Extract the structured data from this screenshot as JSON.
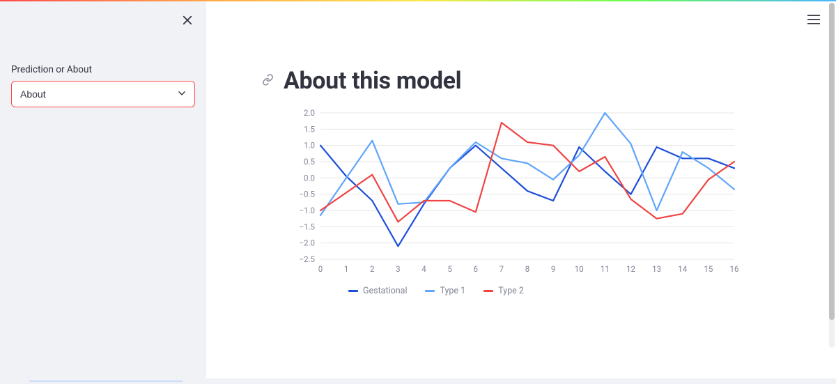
{
  "sidebar": {
    "label": "Prediction or About",
    "selected": "About"
  },
  "main": {
    "title": "About this model"
  },
  "chart_data": {
    "type": "line",
    "x": [
      0,
      1,
      2,
      3,
      4,
      5,
      6,
      7,
      8,
      9,
      10,
      11,
      12,
      13,
      14,
      15,
      16
    ],
    "xlim": [
      0,
      16
    ],
    "ylim": [
      -2.5,
      2.0
    ],
    "yticks": [
      -2.5,
      -2.0,
      -1.5,
      -1.0,
      -0.5,
      0.0,
      0.5,
      1.0,
      1.5,
      2.0
    ],
    "yticklabels": [
      "−2.5",
      "−2.0",
      "−1.5",
      "−1.0",
      "−0.5",
      "0.0",
      "0.5",
      "1.0",
      "1.5",
      "2.0"
    ],
    "xticks": [
      0,
      1,
      2,
      3,
      4,
      5,
      6,
      7,
      8,
      9,
      10,
      11,
      12,
      13,
      14,
      15,
      16
    ],
    "series": [
      {
        "name": "Gestational",
        "color": "#1c4ed8",
        "values": [
          1.0,
          0.05,
          -0.7,
          -2.1,
          -0.8,
          0.3,
          1.0,
          0.3,
          -0.4,
          -0.7,
          0.95,
          0.2,
          -0.5,
          0.95,
          0.6,
          0.6,
          0.3
        ]
      },
      {
        "name": "Type 1",
        "color": "#60a5fa",
        "values": [
          -1.15,
          0.0,
          1.15,
          -0.8,
          -0.75,
          0.3,
          1.1,
          0.6,
          0.45,
          -0.05,
          0.7,
          2.0,
          1.05,
          -1.0,
          0.8,
          0.3,
          -0.35
        ]
      },
      {
        "name": "Type 2",
        "color": "#ef4444",
        "values": [
          -1.0,
          -0.45,
          0.1,
          -1.35,
          -0.7,
          -0.7,
          -1.05,
          1.7,
          1.1,
          1.0,
          0.2,
          0.65,
          -0.65,
          -1.25,
          -1.1,
          -0.05,
          0.5
        ]
      }
    ],
    "legend_position": "bottom"
  }
}
